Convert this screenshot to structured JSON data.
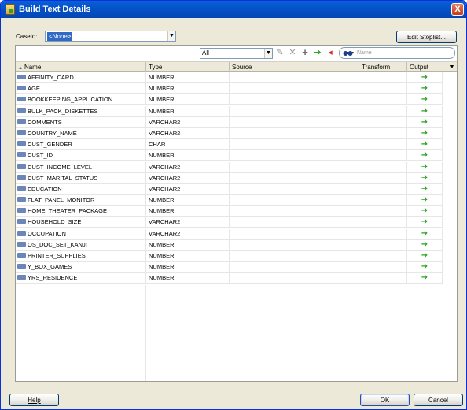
{
  "window": {
    "title": "Build Text Details",
    "close_glyph": "X"
  },
  "caseid": {
    "label": "CaseId:",
    "value": "<None>"
  },
  "buttons": {
    "edit_stoplist": "Edit Stoplist...",
    "help": "Help",
    "ok": "OK",
    "cancel": "Cancel"
  },
  "toolbar": {
    "filter_value": "All",
    "search_placeholder": "Name"
  },
  "columns": [
    "Name",
    "Type",
    "Source",
    "Transform",
    "Output"
  ],
  "rows": [
    {
      "name": "AFFINITY_CARD",
      "type": "NUMBER"
    },
    {
      "name": "AGE",
      "type": "NUMBER"
    },
    {
      "name": "BOOKKEEPING_APPLICATION",
      "type": "NUMBER"
    },
    {
      "name": "BULK_PACK_DISKETTES",
      "type": "NUMBER"
    },
    {
      "name": "COMMENTS",
      "type": "VARCHAR2"
    },
    {
      "name": "COUNTRY_NAME",
      "type": "VARCHAR2"
    },
    {
      "name": "CUST_GENDER",
      "type": "CHAR"
    },
    {
      "name": "CUST_ID",
      "type": "NUMBER"
    },
    {
      "name": "CUST_INCOME_LEVEL",
      "type": "VARCHAR2"
    },
    {
      "name": "CUST_MARITAL_STATUS",
      "type": "VARCHAR2"
    },
    {
      "name": "EDUCATION",
      "type": "VARCHAR2"
    },
    {
      "name": "FLAT_PANEL_MONITOR",
      "type": "NUMBER"
    },
    {
      "name": "HOME_THEATER_PACKAGE",
      "type": "NUMBER"
    },
    {
      "name": "HOUSEHOLD_SIZE",
      "type": "VARCHAR2"
    },
    {
      "name": "OCCUPATION",
      "type": "VARCHAR2"
    },
    {
      "name": "OS_DOC_SET_KANJI",
      "type": "NUMBER"
    },
    {
      "name": "PRINTER_SUPPLIES",
      "type": "NUMBER"
    },
    {
      "name": "Y_BOX_GAMES",
      "type": "NUMBER"
    },
    {
      "name": "YRS_RESIDENCE",
      "type": "NUMBER"
    }
  ],
  "icons": {
    "attribute": "attribute-type-icon",
    "output": "green-arrow-icon",
    "output_glyph": "➔"
  }
}
